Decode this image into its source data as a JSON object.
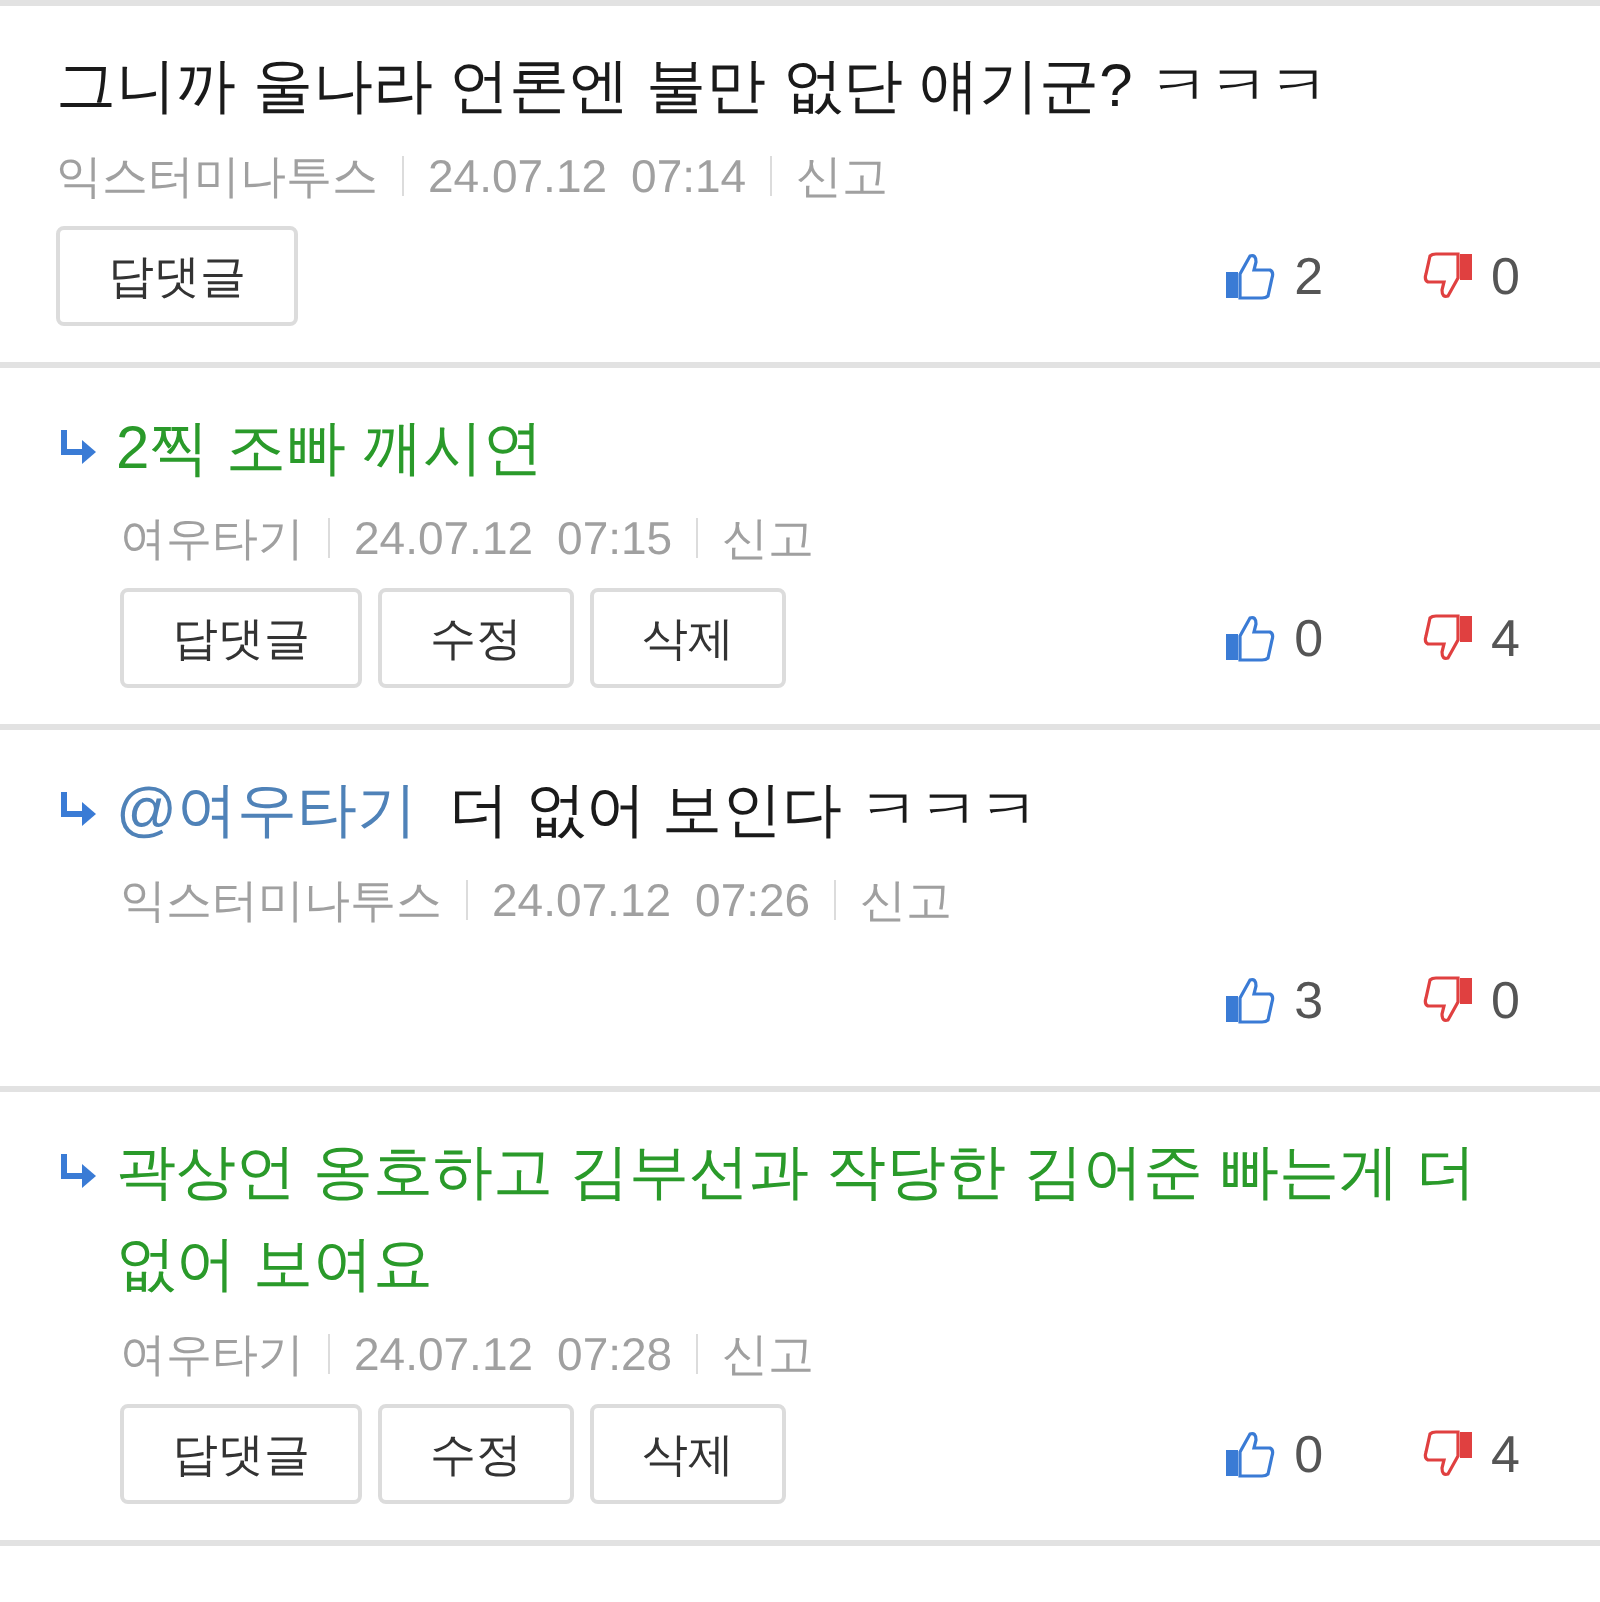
{
  "comments": [
    {
      "reply": false,
      "own": false,
      "text": "그니까 울나라 언론엔 불만 없단 얘기군? ㅋㅋㅋ",
      "author": "익스터미나투스",
      "date": "24.07.12",
      "time": "07:14",
      "report": "신고",
      "buttons": [
        "답댓글"
      ],
      "likes": "2",
      "dislikes": "0"
    },
    {
      "reply": true,
      "own": true,
      "text": "2찍 조빠 깨시연",
      "author": "여우타기",
      "date": "24.07.12",
      "time": "07:15",
      "report": "신고",
      "buttons": [
        "답댓글",
        "수정",
        "삭제"
      ],
      "likes": "0",
      "dislikes": "4"
    },
    {
      "reply": true,
      "own": false,
      "mention": "@여우타기",
      "text": "더 없어 보인다 ㅋㅋㅋ",
      "author": "익스터미나투스",
      "date": "24.07.12",
      "time": "07:26",
      "report": "신고",
      "likes": "3",
      "dislikes": "0"
    },
    {
      "reply": true,
      "own": true,
      "text": "곽상언 옹호하고 김부선과 작당한 김어준 빠는게 더 없어 보여요",
      "author": "여우타기",
      "date": "24.07.12",
      "time": "07:28",
      "report": "신고",
      "buttons": [
        "답댓글",
        "수정",
        "삭제"
      ],
      "likes": "0",
      "dislikes": "4"
    }
  ]
}
